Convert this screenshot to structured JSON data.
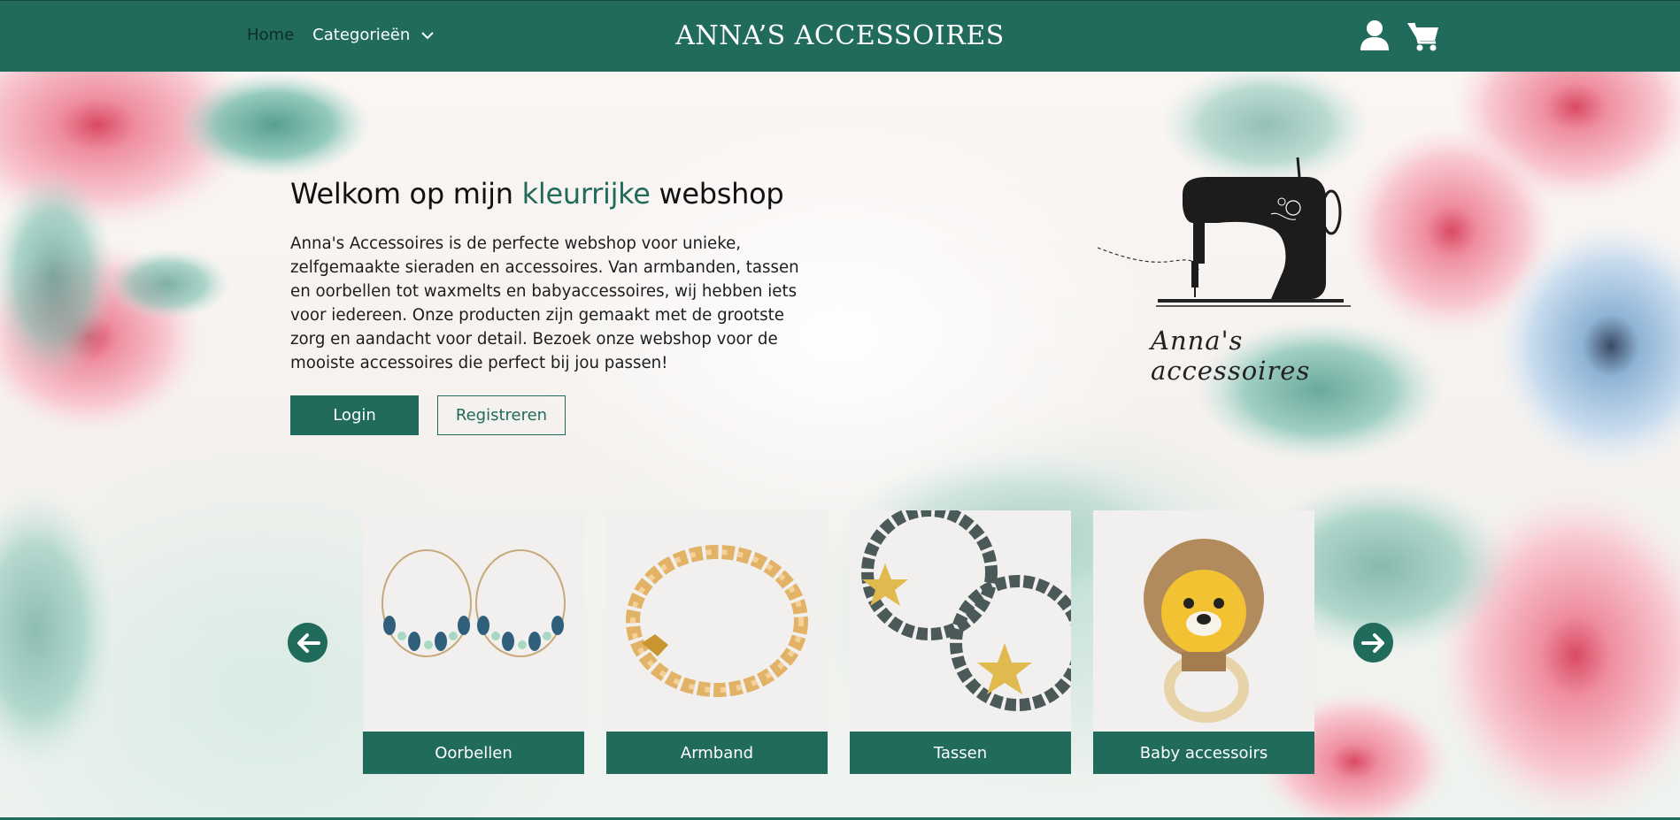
{
  "header": {
    "nav_home": "Home",
    "nav_categories": "Categorieën",
    "brand": "ANNA’S ACCESSOIRES",
    "icons": [
      "user-icon",
      "shopping-cart-icon"
    ]
  },
  "intro": {
    "heading_pre": "Welkom op mijn ",
    "heading_accent": "kleurrijke",
    "heading_post": " webshop",
    "body": "Anna's Accessoires is de perfecte webshop voor unieke, zelfgemaakte sieraden en accessoires. Van armbanden, tassen en oorbellen tot waxmelts en babyaccessoires, wij hebben iets voor iedereen. Onze producten zijn gemaakt met de grootste zorg en aandacht voor detail. Bezoek onze webshop voor de mooiste accessoires die perfect bij jou passen!",
    "login_label": "Login",
    "register_label": "Registreren"
  },
  "logo": {
    "text": "Anna's accessoires",
    "icon": "sewing-machine-icon"
  },
  "carousel": {
    "prev_icon": "arrow-left-icon",
    "next_icon": "arrow-right-icon",
    "cards": [
      {
        "label": "Oorbellen"
      },
      {
        "label": "Armband"
      },
      {
        "label": "Tassen"
      },
      {
        "label": "Baby accessoirs"
      }
    ]
  },
  "colors": {
    "primary": "#216b5c",
    "white": "#ffffff",
    "text": "#1a1a1a"
  }
}
